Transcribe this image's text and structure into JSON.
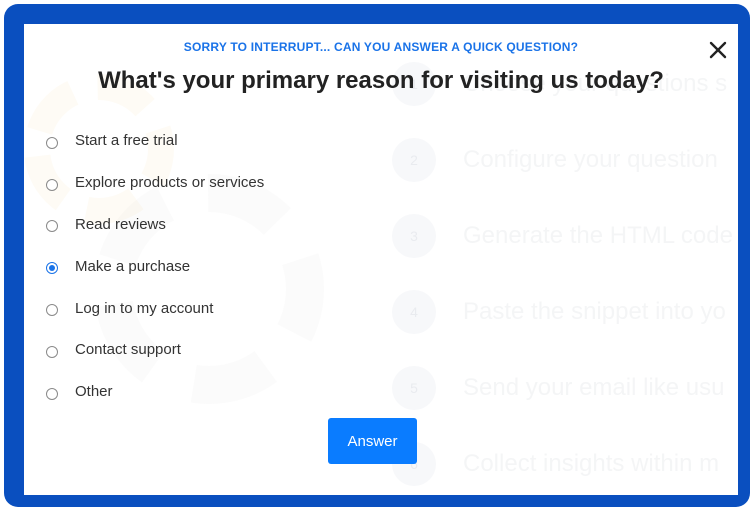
{
  "survey": {
    "kicker": "SORRY TO INTERRUPT... CAN YOU ANSWER A QUICK QUESTION?",
    "question": "What's your primary reason for visiting us today?",
    "options": [
      {
        "label": "Start a free trial",
        "selected": false
      },
      {
        "label": "Explore products or services",
        "selected": false
      },
      {
        "label": "Read reviews",
        "selected": false
      },
      {
        "label": "Make a purchase",
        "selected": true
      },
      {
        "label": "Log in to my account",
        "selected": false
      },
      {
        "label": "Contact support",
        "selected": false
      },
      {
        "label": "Other",
        "selected": false
      }
    ],
    "submit_label": "Answer",
    "close_icon": "close-icon"
  },
  "background": {
    "steps": [
      {
        "number": "1",
        "text": "Choose your questions s"
      },
      {
        "number": "2",
        "text": "Configure your question"
      },
      {
        "number": "3",
        "text": "Generate the HTML code"
      },
      {
        "number": "4",
        "text": "Paste the snippet into yo"
      },
      {
        "number": "5",
        "text": "Send your email like usu"
      },
      {
        "number": "6",
        "text": "Collect insights within m"
      }
    ]
  },
  "colors": {
    "frame": "#0a4fbf",
    "accent": "#1a73e8",
    "button": "#0a7cff"
  }
}
